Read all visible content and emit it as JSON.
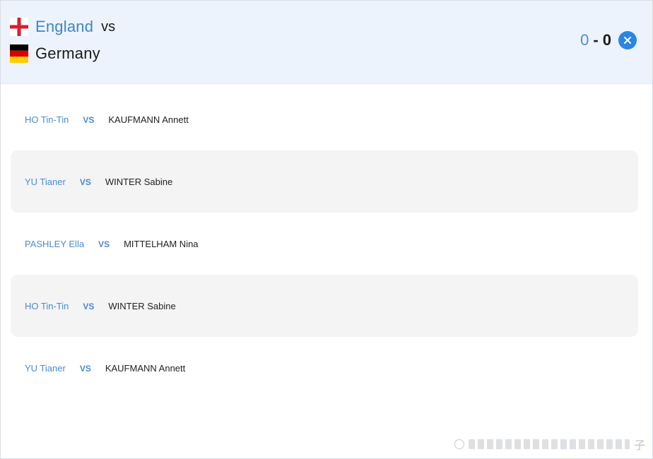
{
  "header": {
    "home_team": "England",
    "vs_label": "vs",
    "away_team": "Germany",
    "home_score": "0",
    "score_separator": "-",
    "away_score": "0",
    "close_icon": "close-icon",
    "home_flag_icon": "england-flag-icon",
    "away_flag_icon": "germany-flag-icon"
  },
  "matches": [
    {
      "home_player": "HO Tin-Tin",
      "vs": "VS",
      "away_player": "KAUFMANN Annett"
    },
    {
      "home_player": "YU Tianer",
      "vs": "VS",
      "away_player": "WINTER Sabine"
    },
    {
      "home_player": "PASHLEY Ella",
      "vs": "VS",
      "away_player": "MITTELHAM Nina"
    },
    {
      "home_player": "HO Tin-Tin",
      "vs": "VS",
      "away_player": "WINTER Sabine"
    },
    {
      "home_player": "YU Tianer",
      "vs": "VS",
      "away_player": "KAUFMANN Annett"
    }
  ],
  "watermark": {
    "char": "子"
  },
  "colors": {
    "accent": "#3d85c9",
    "header_bg": "#edf3fc",
    "close_button": "#2a86e2",
    "alt_row_bg": "#f4f4f4"
  }
}
